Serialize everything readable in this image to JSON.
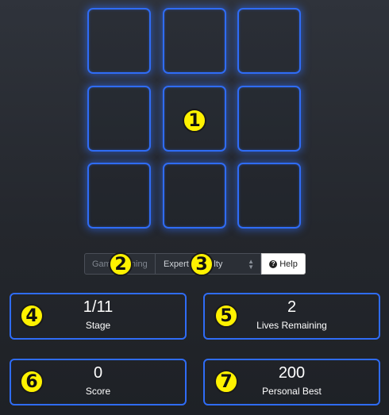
{
  "board": {
    "cells": [
      "",
      "",
      "",
      "",
      "",
      "",
      "",
      "",
      ""
    ]
  },
  "markers": [
    "1",
    "2",
    "3",
    "4",
    "5",
    "6",
    "7"
  ],
  "controls": {
    "status_text": "Game running",
    "difficulty_selected": "Expert difficulty",
    "help_label": "Help"
  },
  "stats": {
    "stage": {
      "value": "1/11",
      "label": "Stage"
    },
    "lives": {
      "value": "2",
      "label": "Lives Remaining"
    },
    "score": {
      "value": "0",
      "label": "Score"
    },
    "best": {
      "value": "200",
      "label": "Personal Best"
    }
  },
  "colors": {
    "accent": "#2f6cf6",
    "marker": "#fff200",
    "background": "#2a2d33"
  }
}
